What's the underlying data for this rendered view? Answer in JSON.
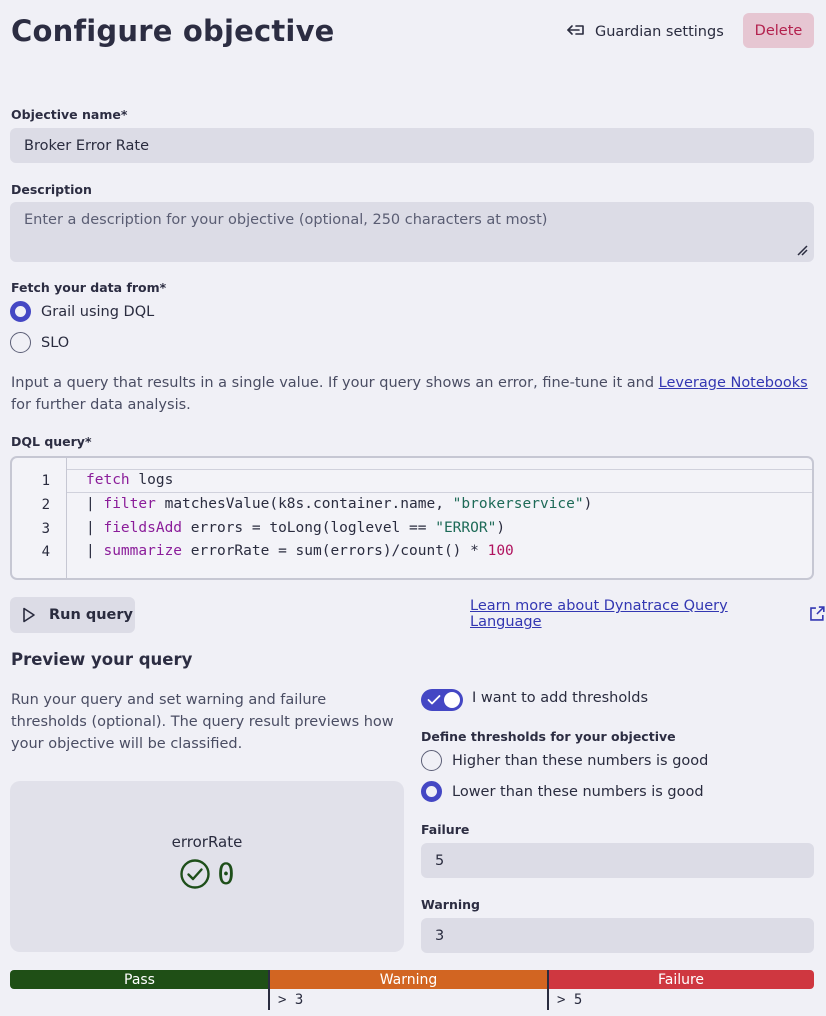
{
  "header": {
    "title": "Configure objective",
    "guardian_settings_label": "Guardian settings",
    "delete_label": "Delete"
  },
  "form": {
    "objective_name_label": "Objective name*",
    "objective_name_value": "Broker Error Rate",
    "description_label": "Description",
    "description_placeholder": "Enter a description for your objective (optional, 250 characters at most)",
    "fetch_label": "Fetch your data from*",
    "fetch_options": [
      {
        "label": "Grail using DQL",
        "selected": true
      },
      {
        "label": "SLO",
        "selected": false
      }
    ],
    "help_text_before": "Input a query that results in a single value. If your query shows an error, fine-tune it and ",
    "help_link": "Leverage Notebooks",
    "help_text_after": " for further data analysis.",
    "dql_label": "DQL query*"
  },
  "editor": {
    "line_numbers": [
      "1",
      "2",
      "3",
      "4"
    ],
    "lines": {
      "l1_kw": "fetch",
      "l1_rest": " logs",
      "l2_pipe": "| ",
      "l2_kw": "filter",
      "l2_rest": " matchesValue(k8s.container.name, ",
      "l2_str": "\"brokerservice\"",
      "l2_end": ")",
      "l3_pipe": "| ",
      "l3_kw": "fieldsAdd",
      "l3_rest": " errors = toLong(loglevel == ",
      "l3_str": "\"ERROR\"",
      "l3_end": ")",
      "l4_pipe": "| ",
      "l4_kw": "summarize",
      "l4_rest": " errorRate = sum(errors)/count() * ",
      "l4_num": "100"
    }
  },
  "actions": {
    "run_query_label": "Run query",
    "learn_more_label": "Learn more about Dynatrace Query Language"
  },
  "preview": {
    "title": "Preview your query",
    "description": "Run your query and set warning and failure thresholds (optional). The query result previews how your objective will be classified.",
    "metric_name": "errorRate",
    "metric_value": "0",
    "status": "pass"
  },
  "thresholds": {
    "toggle_label": "I want to add thresholds",
    "toggle_on": true,
    "define_label": "Define thresholds for your objective",
    "options": [
      {
        "label": "Higher than these numbers is good",
        "selected": false
      },
      {
        "label": "Lower than these numbers is good",
        "selected": true
      }
    ],
    "failure_label": "Failure",
    "failure_value": "5",
    "warning_label": "Warning",
    "warning_value": "3"
  },
  "scale": {
    "pass_label": "Pass",
    "warning_label": "Warning",
    "failure_label": "Failure",
    "warning_tick": "> 3",
    "failure_tick": "> 5",
    "colors": {
      "pass": "#1f4f16",
      "warning": "#d26522",
      "failure": "#cf3740"
    }
  }
}
